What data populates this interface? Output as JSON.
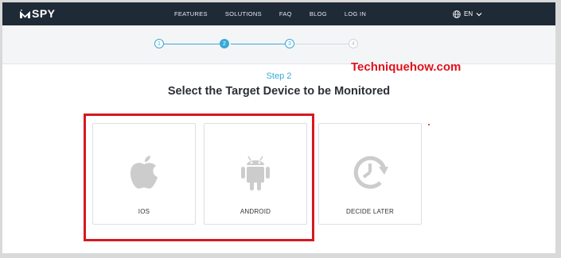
{
  "colors": {
    "nav_bg": "#1f2a37",
    "accent": "#39a9d6",
    "highlight_border": "#d6181f",
    "watermark": "#e0101b",
    "inactive_step": "#cfd4da"
  },
  "brand": {
    "logo_text": "SPY",
    "logo_icon": "mspy-m-icon"
  },
  "nav": {
    "items": [
      {
        "label": "FEATURES"
      },
      {
        "label": "SOLUTIONS"
      },
      {
        "label": "FAQ"
      },
      {
        "label": "BLOG"
      },
      {
        "label": "LOG IN"
      }
    ],
    "language": {
      "label": "EN",
      "icon": "globe-icon",
      "caret": "chevron-down-icon"
    }
  },
  "stepper": {
    "steps": [
      {
        "number": "1",
        "state": "completed"
      },
      {
        "number": "2",
        "state": "current"
      },
      {
        "number": "3",
        "state": "pending"
      },
      {
        "number": "4",
        "state": "pending"
      }
    ]
  },
  "watermark": "Techniquehow.com",
  "main": {
    "step_label": "Step 2",
    "title": "Select the Target Device to be Monitored",
    "devices": [
      {
        "label": "IOS",
        "icon": "apple-icon"
      },
      {
        "label": "ANDROID",
        "icon": "android-icon"
      },
      {
        "label": "DECIDE LATER",
        "icon": "clock-refresh-icon"
      }
    ]
  }
}
